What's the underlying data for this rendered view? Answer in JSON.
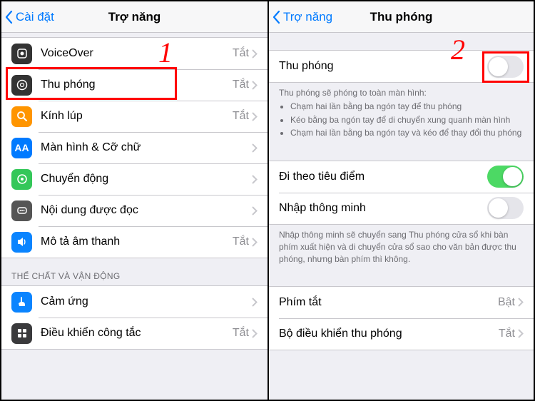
{
  "left": {
    "back_label": "Cài đặt",
    "title": "Trợ năng",
    "items": [
      {
        "label": "VoiceOver",
        "value": "Tắt"
      },
      {
        "label": "Thu phóng",
        "value": "Tắt"
      },
      {
        "label": "Kính lúp",
        "value": "Tắt"
      },
      {
        "label": "Màn hình & Cỡ chữ",
        "value": ""
      },
      {
        "label": "Chuyển động",
        "value": ""
      },
      {
        "label": "Nội dung được đọc",
        "value": ""
      },
      {
        "label": "Mô tả âm thanh",
        "value": "Tắt"
      }
    ],
    "section2_header": "THỂ CHẤT VÀ VẬN ĐỘNG",
    "items2": [
      {
        "label": "Cảm ứng",
        "value": ""
      },
      {
        "label": "Điều khiển công tắc",
        "value": "Tắt"
      }
    ]
  },
  "right": {
    "back_label": "Trợ năng",
    "title": "Thu phóng",
    "main_toggle": {
      "label": "Thu phóng",
      "on": false
    },
    "footer1_head": "Thu phóng sẽ phóng to toàn màn hình:",
    "footer1_bullets": [
      "Chạm hai lần bằng ba ngón tay để thu phóng",
      "Kéo bằng ba ngón tay để di chuyển xung quanh màn hình",
      "Chạm hai lần bằng ba ngón tay và kéo để thay đổi thu phóng"
    ],
    "items2": [
      {
        "label": "Đi theo tiêu điểm",
        "on": true
      },
      {
        "label": "Nhập thông minh",
        "on": false
      }
    ],
    "footer2": "Nhập thông minh sẽ chuyển sang Thu phóng cửa sổ khi bàn phím xuất hiện và di chuyển cửa sổ sao cho văn bản được thu phóng, nhưng bàn phím thì không.",
    "items3": [
      {
        "label": "Phím tắt",
        "value": "Bật"
      },
      {
        "label": "Bộ điều khiển thu phóng",
        "value": "Tắt"
      }
    ]
  },
  "annotations": {
    "num1": "1",
    "num2": "2"
  }
}
